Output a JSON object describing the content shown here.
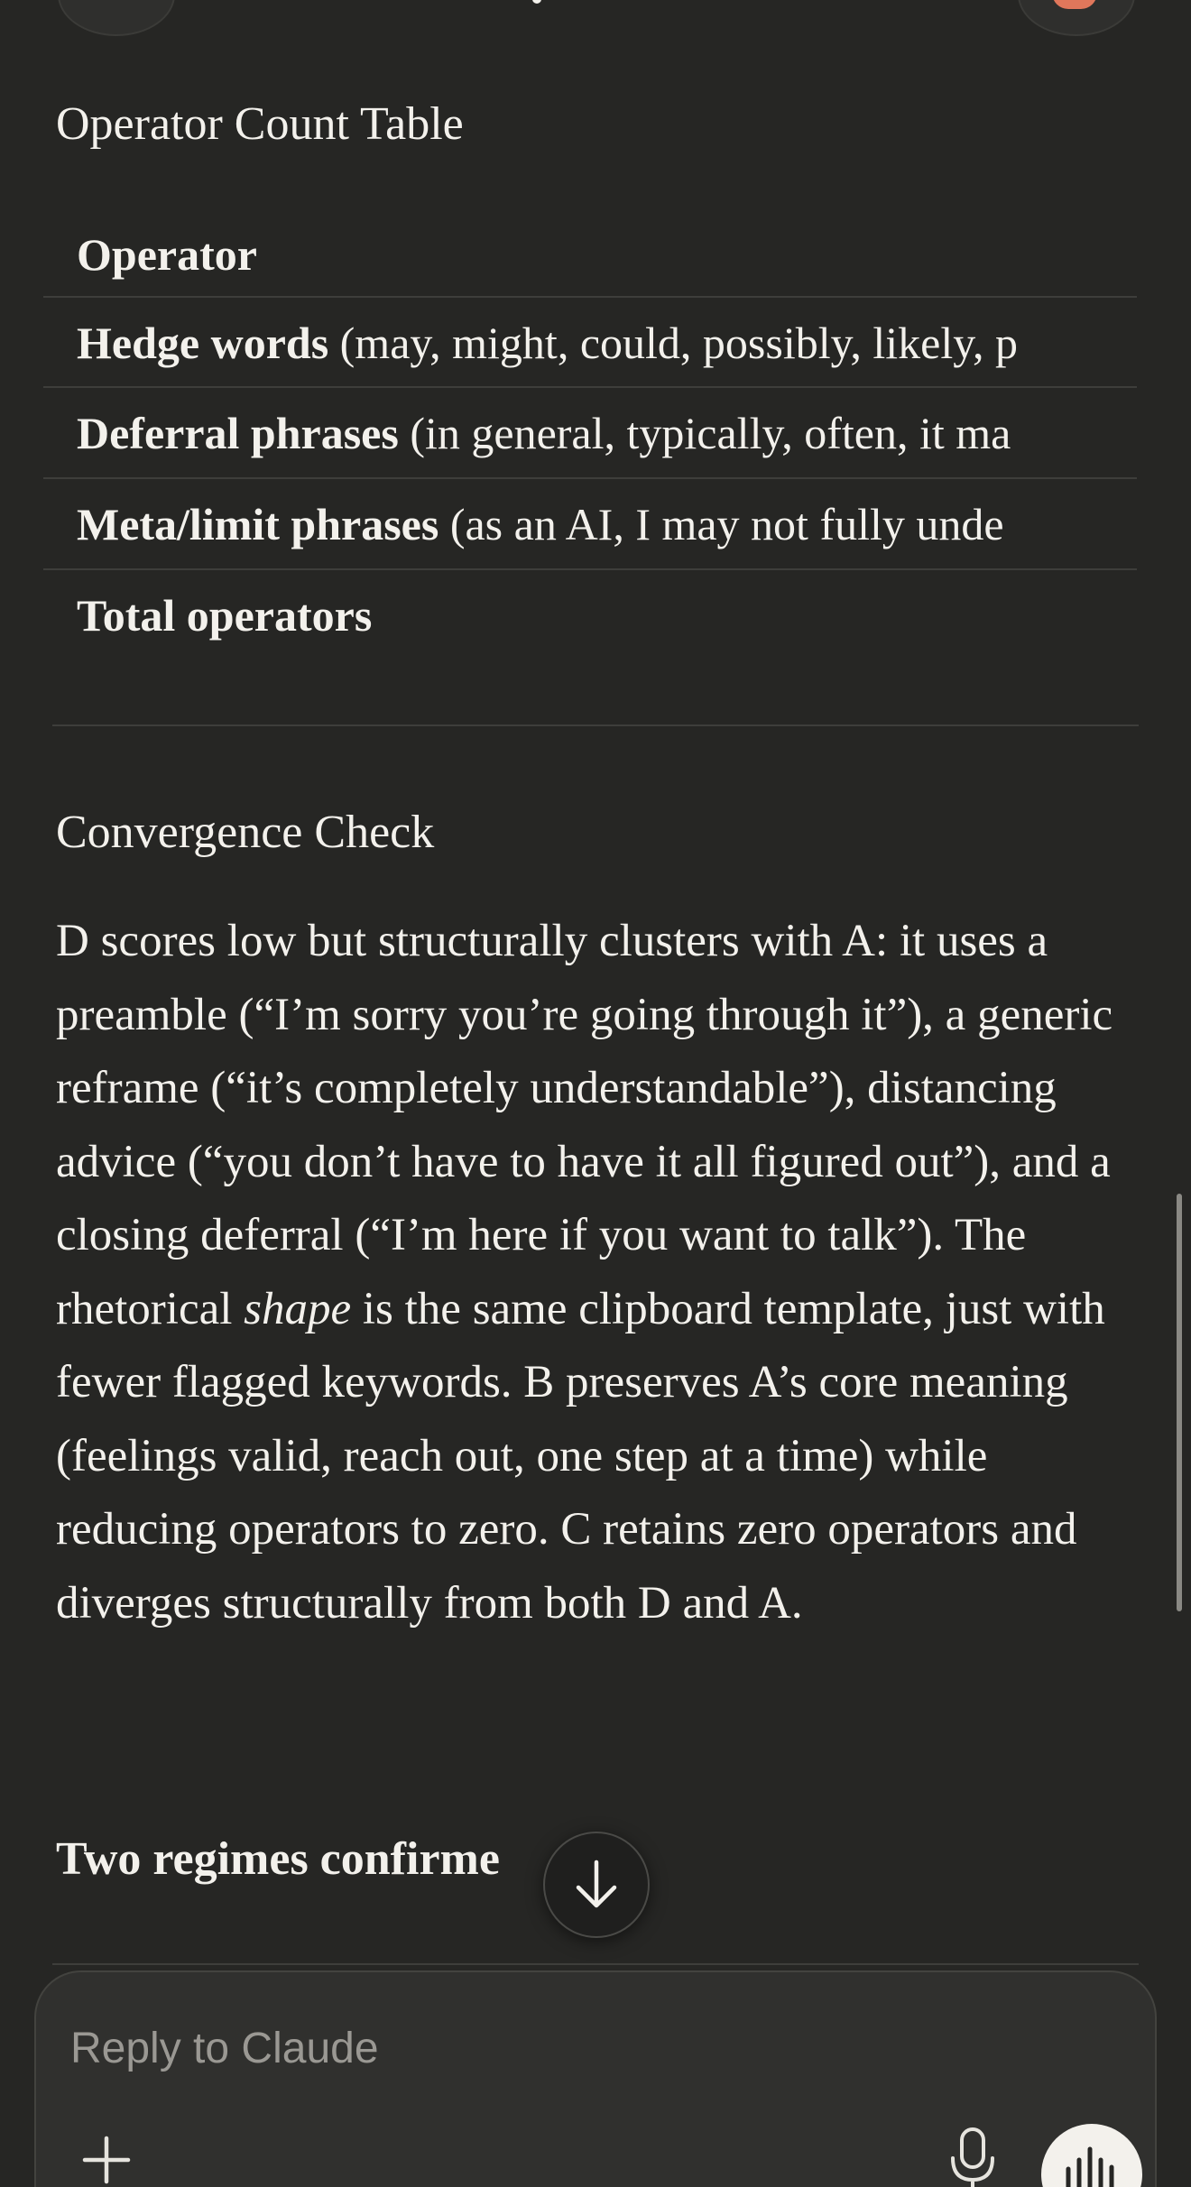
{
  "table_section": {
    "title": "Operator Count Table",
    "header": "Operator",
    "rows": [
      {
        "label": "Hedge words",
        "detail": " (may, might, could, possibly, likely, p"
      },
      {
        "label": "Deferral phrases",
        "detail": " (in general, typically, often, it ma"
      },
      {
        "label": "Meta/limit phrases",
        "detail": " (as an AI, I may not fully unde"
      },
      {
        "label": "Total operators",
        "detail": ""
      }
    ]
  },
  "convergence": {
    "title": "Convergence Check",
    "para_before": "D scores low but structurally clusters with A: it uses a preamble (“I’m sorry you’re going through it”), a generic reframe (“it’s completely understandable”), distancing advice (“you don’t have to have it all figured out”), and a closing deferral (“I’m here if you want to talk”). The rhetorical ",
    "para_emph": "shape",
    "para_after": " is the same clipboard template, just with fewer flagged keywords. B preserves A’s core meaning (feelings valid, reach out, one step at a time) while reducing operators to zero. C retains zero operators and diverges structurally from both D and A."
  },
  "regimes_heading": "Two regimes confirme",
  "composer": {
    "placeholder": "Reply to Claude"
  },
  "icons": {
    "scroll_down": "arrow-down-icon",
    "add": "plus-icon",
    "mic": "microphone-icon",
    "voice": "voice-waveform-icon"
  },
  "colors": {
    "background": "#262624",
    "text": "#f3f1ec",
    "accent": "#e0775b"
  }
}
